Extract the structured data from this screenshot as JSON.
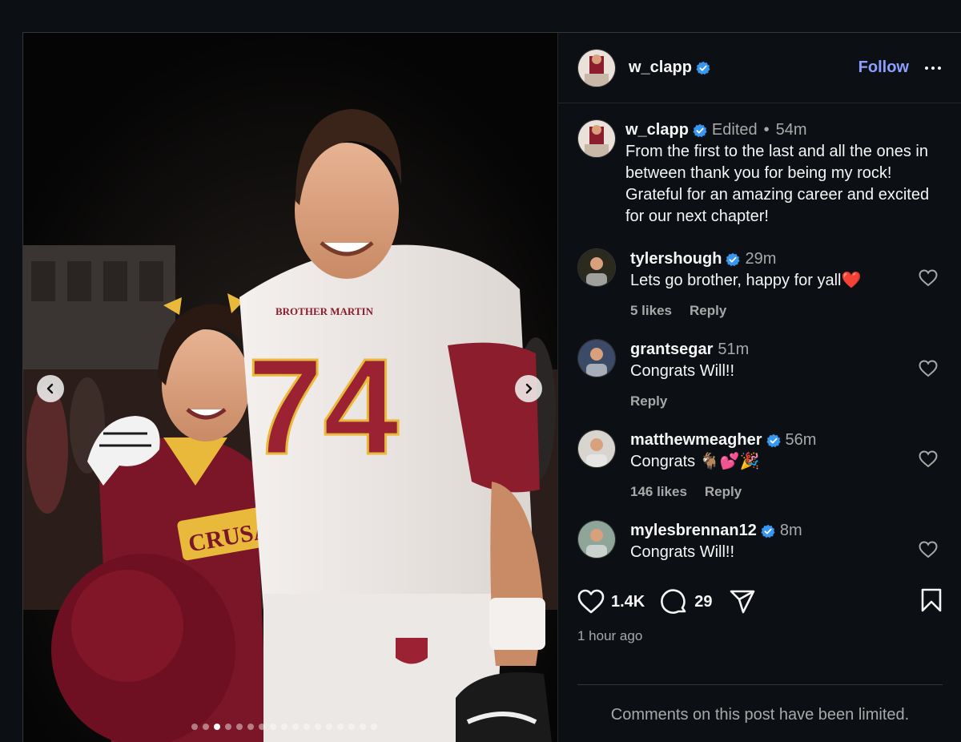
{
  "post": {
    "author": {
      "username": "w_clapp",
      "verified": true,
      "avatar": "profile-photo"
    },
    "follow_label": "Follow",
    "more_icon": "more-horizontal-icon",
    "caption": {
      "username": "w_clapp",
      "edited_label": "Edited",
      "separator": "•",
      "time": "54m",
      "text": "From the first to the last and all the ones in between thank you for being my rock! Grateful for an amazing career and excited for our next chapter!"
    },
    "comments": [
      {
        "username": "tylershough",
        "verified": true,
        "time": "29m",
        "text": "Lets go brother, happy for yall❤️",
        "likes": "5 likes",
        "reply": "Reply"
      },
      {
        "username": "grantsegar",
        "verified": false,
        "time": "51m",
        "text": "Congrats Will!!",
        "likes": "",
        "reply": "Reply"
      },
      {
        "username": "matthewmeagher",
        "verified": true,
        "time": "56m",
        "text": "Congrats 🐐💕🎉",
        "likes": "146 likes",
        "reply": "Reply"
      },
      {
        "username": "mylesbrennan12",
        "verified": true,
        "time": "8m",
        "text": "Congrats Will!!",
        "likes": "",
        "reply": ""
      }
    ],
    "like_count": "1.4K",
    "comment_count": "29",
    "timestamp": "1 hour ago",
    "limited_notice": "Comments on this post have been limited.",
    "carousel": {
      "total": 17,
      "active_index": 2
    },
    "photo_text": {
      "jersey_name": "BROTHER MARTIN",
      "jersey_number": "74",
      "uniform_text": "CRUSADERS"
    },
    "colors": {
      "accent": "#8c9eff",
      "verified": "#3897f0",
      "background": "#0c1014",
      "maroon": "#8b1d2c",
      "gold": "#e8b93a"
    }
  }
}
